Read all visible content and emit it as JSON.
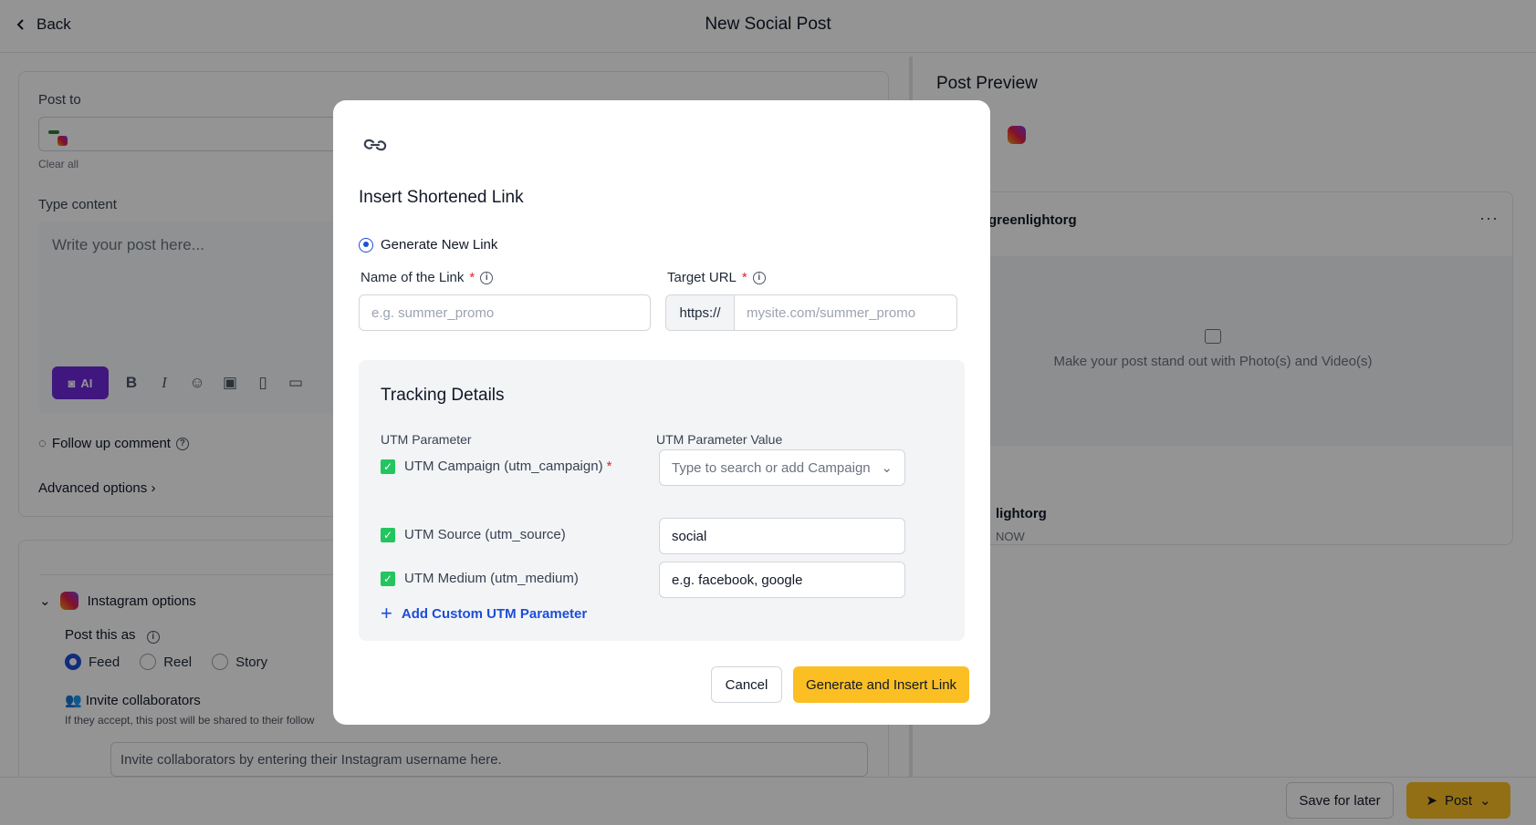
{
  "header": {
    "back_label": "Back",
    "title": "New Social Post"
  },
  "editor": {
    "post_to_label": "Post to",
    "clear_all": "Clear all",
    "type_content_label": "Type content",
    "content_placeholder": "Write your post here...",
    "ai_label": "AI",
    "follow_up_label": "Follow up comment",
    "advanced_label": "Advanced options"
  },
  "instagram": {
    "section_label": "Instagram options",
    "post_as_label": "Post this as",
    "options": [
      "Feed",
      "Reel",
      "Story"
    ],
    "selected": "Feed",
    "invite_label": "Invite collaborators",
    "invite_sub": "If they accept, this post will be shared to their follow",
    "invite_placeholder": "Invite collaborators by entering their Instagram username here."
  },
  "preview": {
    "title": "Post Preview",
    "username": "greenlightorg",
    "menu_glyph": "···",
    "media_text": "Make your post stand out with Photo(s) and Video(s)",
    "name_partial": "lightorg",
    "time": "NOW"
  },
  "footer": {
    "save_label": "Save for later",
    "post_label": "Post"
  },
  "modal": {
    "title": "Insert Shortened Link",
    "mode_option": "Generate New Link",
    "name_label": "Name of the Link",
    "name_placeholder": "e.g. summer_promo",
    "url_label": "Target URL",
    "url_prefix": "https://",
    "url_placeholder": "mysite.com/summer_promo",
    "required_mark": "*",
    "tracking": {
      "title": "Tracking Details",
      "col_param": "UTM Parameter",
      "col_value": "UTM Parameter Value",
      "rows": [
        {
          "label": "UTM Campaign (utm_campaign)",
          "required": true,
          "value": "Type to search or add Campaign"
        },
        {
          "label": "UTM Source (utm_source)",
          "required": false,
          "value": "social"
        },
        {
          "label": "UTM Medium (utm_medium)",
          "required": false,
          "value": "e.g. facebook, google"
        }
      ],
      "add_custom": "Add Custom UTM Parameter"
    },
    "cancel_label": "Cancel",
    "generate_label": "Generate and Insert Link"
  },
  "colors": {
    "accent": "#fbbf24",
    "ai_purple": "#6d28d9",
    "link_blue": "#1d4ed8",
    "check_green": "#22c55e"
  }
}
